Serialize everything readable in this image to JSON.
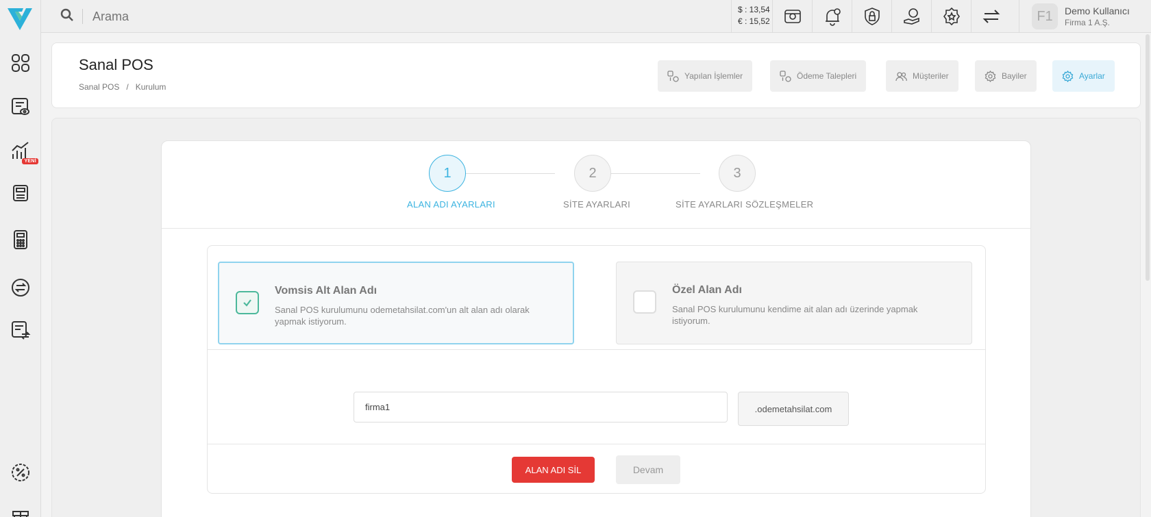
{
  "search": {
    "placeholder": "Arama"
  },
  "rates": {
    "usd": "$ : 13,54",
    "eur": "€ : 15,52"
  },
  "user": {
    "initials": "F1",
    "name": "Demo Kullanıcı",
    "company": "Firma 1 A.Ş."
  },
  "sidebar": {
    "new_badge": "YENİ"
  },
  "header": {
    "title": "Sanal POS",
    "breadcrumb": [
      "Sanal POS",
      "/",
      "Kurulum"
    ],
    "buttons": [
      "Yapılan İşlemler",
      "Ödeme Talepleri",
      "Müşteriler",
      "Bayiler",
      "Ayarlar"
    ]
  },
  "wizard": {
    "steps": [
      {
        "num": "1",
        "label": "ALAN ADI AYARLARI"
      },
      {
        "num": "2",
        "label": "SİTE AYARLARI"
      },
      {
        "num": "3",
        "label": "SİTE AYARLARI SÖZLEŞMELER"
      }
    ],
    "options": [
      {
        "title": "Vomsis Alt Alan Adı",
        "desc": "Sanal POS kurulumunu odemetahsilat.com'un alt alan adı olarak yapmak istiyorum.",
        "selected": true
      },
      {
        "title": "Özel Alan Adı",
        "desc": "Sanal POS kurulumunu kendime ait alan adı üzerinde yapmak istiyorum.",
        "selected": false
      }
    ],
    "domain_value": "firma1",
    "domain_suffix": ".odemetahsilat.com",
    "delete_label": "ALAN ADI SİL",
    "next_label": "Devam"
  },
  "colors": {
    "accent": "#3bb3e0",
    "danger": "#e53935",
    "check": "#4cb89b"
  }
}
